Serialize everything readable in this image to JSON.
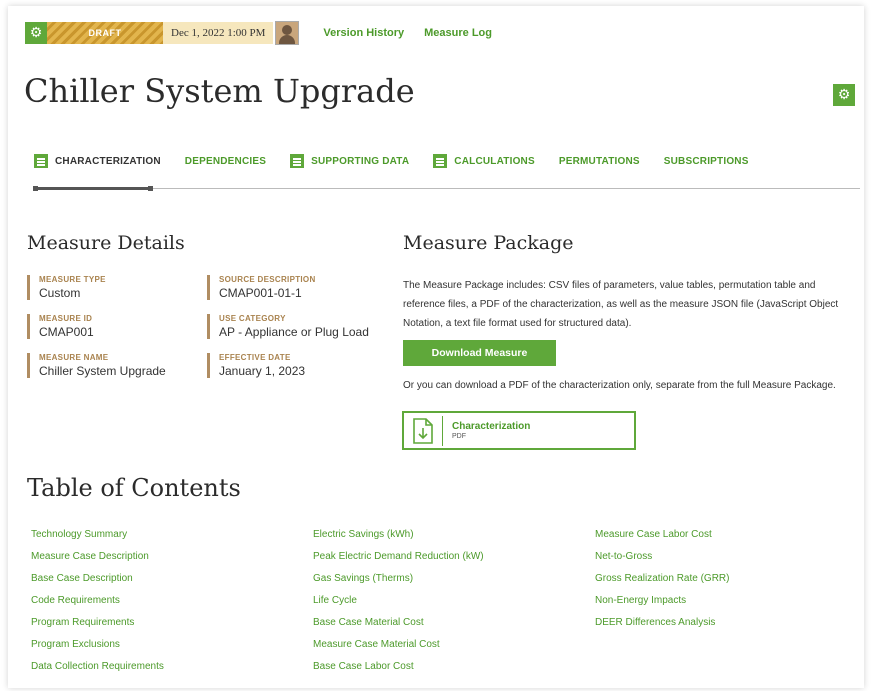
{
  "topbar": {
    "status_label": "DRAFT",
    "date": "Dec 1, 2022 1:00 PM",
    "links": [
      "Version History",
      "Measure Log"
    ]
  },
  "page_title": "Chiller System Upgrade",
  "tabs": [
    {
      "label": "CHARACTERIZATION",
      "icon": "list-icon",
      "active": true
    },
    {
      "label": "DEPENDENCIES",
      "icon": null,
      "active": false
    },
    {
      "label": "SUPPORTING DATA",
      "icon": "list-icon",
      "active": false
    },
    {
      "label": "CALCULATIONS",
      "icon": "list-icon",
      "active": false
    },
    {
      "label": "PERMUTATIONS",
      "icon": null,
      "active": false
    },
    {
      "label": "SUBSCRIPTIONS",
      "icon": null,
      "active": false
    }
  ],
  "measure_details": {
    "title": "Measure Details",
    "fields": [
      {
        "label": "MEASURE TYPE",
        "value": "Custom"
      },
      {
        "label": "SOURCE DESCRIPTION",
        "value": "CMAP001-01-1"
      },
      {
        "label": "MEASURE ID",
        "value": "CMAP001"
      },
      {
        "label": "USE CATEGORY",
        "value": "AP - Appliance or Plug Load"
      },
      {
        "label": "MEASURE NAME",
        "value": "Chiller System Upgrade"
      },
      {
        "label": "EFFECTIVE DATE",
        "value": "January 1, 2023"
      }
    ]
  },
  "measure_package": {
    "title": "Measure Package",
    "description": "The Measure Package includes: CSV files of parameters, value tables, permutation table and reference files, a PDF of the characterization, as well as the measure JSON file (JavaScript Object Notation, a text file format used for structured data).",
    "download_label": "Download Measure",
    "or_text": "Or you can download a PDF of the characterization only, separate from the full Measure Package.",
    "file": {
      "name": "Characterization",
      "type": "PDF"
    }
  },
  "toc": {
    "title": "Table of Contents",
    "columns": [
      [
        "Technology Summary",
        "Measure Case Description",
        "Base Case Description",
        "Code Requirements",
        "Program Requirements",
        "Program Exclusions",
        "Data Collection Requirements"
      ],
      [
        "Electric Savings (kWh)",
        "Peak Electric Demand Reduction (kW)",
        "Gas Savings (Therms)",
        "Life Cycle",
        "Base Case Material Cost",
        "Measure Case Material Cost",
        "Base Case Labor Cost"
      ],
      [
        "Measure Case Labor Cost",
        "Net-to-Gross",
        "Gross Realization Rate (GRR)",
        "Non-Energy Impacts",
        "DEER Differences Analysis"
      ]
    ]
  },
  "colors": {
    "accent": "#5fa83a",
    "link": "#4c9a2a",
    "label": "#a9834f",
    "draft": "#e2b54d"
  }
}
